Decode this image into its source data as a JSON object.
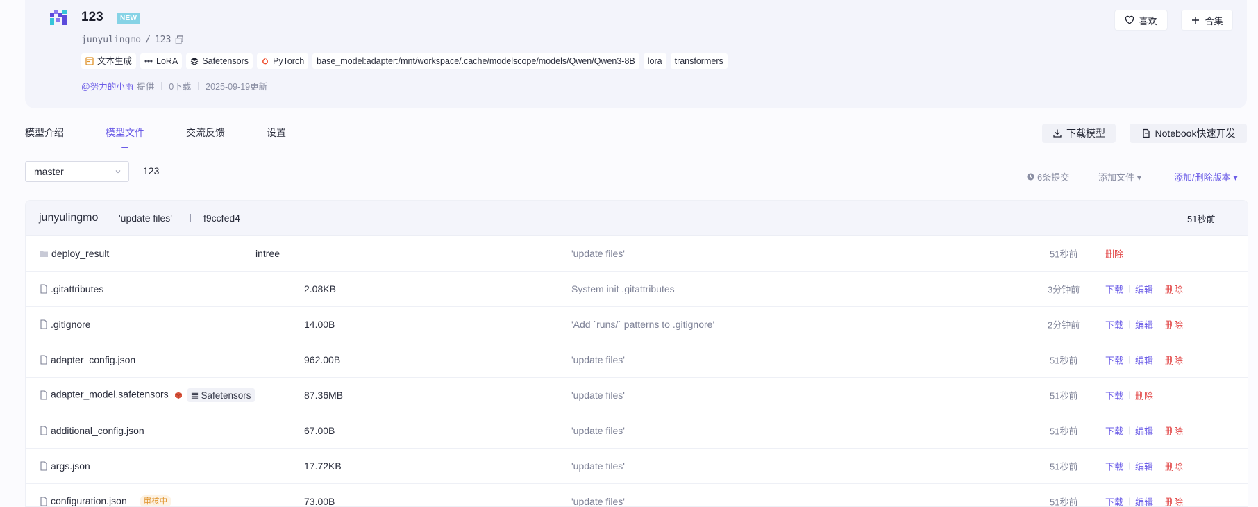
{
  "model": {
    "name": "123",
    "new_badge": "NEW",
    "owner": "junyulingmo",
    "path_sep": "/",
    "repo": "123",
    "tags": [
      {
        "icon": "text-gen-icon",
        "label": "文本生成"
      },
      {
        "icon": "lora-icon",
        "label": "LoRA"
      },
      {
        "icon": "safetensors-icon",
        "label": "Safetensors"
      },
      {
        "icon": "pytorch-icon",
        "label": "PyTorch"
      },
      {
        "icon": "",
        "label": "base_model:adapter:/mnt/workspace/.cache/modelscope/models/Qwen/Qwen3-8B"
      },
      {
        "icon": "",
        "label": "lora"
      },
      {
        "icon": "",
        "label": "transformers"
      }
    ],
    "author": "@努力的小雨",
    "provided": "提供",
    "downloads": "0下载",
    "updated": "2025-09-19更新"
  },
  "header_actions": {
    "like": "喜欢",
    "collect": "合集"
  },
  "tabs": [
    {
      "label": "模型介绍",
      "active": false
    },
    {
      "label": "模型文件",
      "active": true
    },
    {
      "label": "交流反馈",
      "active": false
    },
    {
      "label": "设置",
      "active": false
    }
  ],
  "actions": {
    "download_model": "下载模型",
    "notebook": "Notebook快速开发"
  },
  "branch": {
    "selected": "master",
    "repo_label": "123"
  },
  "toolbar": {
    "commits": "6条提交",
    "add_file": "添加文件 ▾",
    "manage_versions": "添加/删除版本 ▾"
  },
  "last_commit": {
    "user": "junyulingmo",
    "message": "'update files'",
    "hash": "f9ccfed4",
    "time": "51秒前"
  },
  "file_actions": {
    "download": "下载",
    "edit": "编辑",
    "delete": "删除"
  },
  "files": [
    {
      "name": "deploy_result",
      "type": "folder",
      "size": "intree",
      "message": "'update files'",
      "time": "51秒前"
    },
    {
      "name": ".gitattributes",
      "type": "file",
      "size": "2.08KB",
      "message": "System init .gitattributes",
      "time": "3分钟前"
    },
    {
      "name": ".gitignore",
      "type": "file",
      "size": "14.00B",
      "message": "'Add `runs/` patterns to .gitignore'",
      "time": "2分钟前"
    },
    {
      "name": "adapter_config.json",
      "type": "file",
      "size": "962.00B",
      "message": "'update files'",
      "time": "51秒前"
    },
    {
      "name": "adapter_model.safetensors",
      "type": "file",
      "size": "87.36MB",
      "message": "'update files'",
      "time": "51秒前",
      "badge": "Safetensors"
    },
    {
      "name": "additional_config.json",
      "type": "file",
      "size": "67.00B",
      "message": "'update files'",
      "time": "51秒前"
    },
    {
      "name": "args.json",
      "type": "file",
      "size": "17.72KB",
      "message": "'update files'",
      "time": "51秒前"
    },
    {
      "name": "configuration.json",
      "type": "file",
      "size": "73.00B",
      "message": "'update files'",
      "time": "51秒前",
      "status": "审核中"
    }
  ],
  "colors": {
    "accent": "#6b5ce7",
    "danger": "#e24646",
    "new_badge": "#86d3e6",
    "review_badge": "#e0932a"
  }
}
